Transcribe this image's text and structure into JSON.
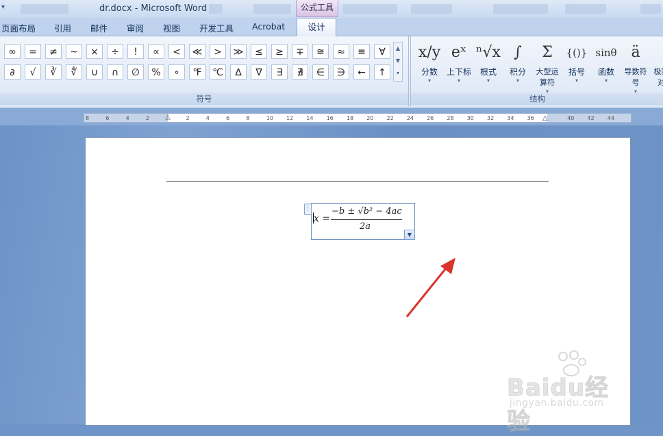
{
  "window": {
    "title": "dr.docx - Microsoft Word",
    "context_tab_group": "公式工具"
  },
  "tabs": [
    {
      "label": "页面布局"
    },
    {
      "label": "引用"
    },
    {
      "label": "邮件"
    },
    {
      "label": "审阅"
    },
    {
      "label": "视图"
    },
    {
      "label": "开发工具"
    },
    {
      "label": "Acrobat"
    },
    {
      "label": "设计",
      "active": true
    }
  ],
  "symbols": {
    "group_label": "符号",
    "row1": [
      "∞",
      "=",
      "≠",
      "~",
      "×",
      "÷",
      "!",
      "∝",
      "<",
      "≪",
      ">",
      "≫",
      "≤",
      "≥",
      "∓",
      "≅",
      "≈",
      "≡",
      "∀"
    ],
    "row2": [
      "∂",
      "√",
      "∛",
      "∜",
      "∪",
      "∩",
      "∅",
      "%",
      "∘",
      "℉",
      "℃",
      "∆",
      "∇",
      "∃",
      "∄",
      "∈",
      "∋",
      "←",
      "↑"
    ]
  },
  "structures": {
    "group_label": "结构",
    "items": [
      {
        "label": "分数",
        "icon": "fraction-icon",
        "glyph": "x/y"
      },
      {
        "label": "上下标",
        "icon": "script-icon",
        "glyph": "eˣ"
      },
      {
        "label": "根式",
        "icon": "radical-icon",
        "glyph": "ⁿ√x"
      },
      {
        "label": "积分",
        "icon": "integral-icon",
        "glyph": "∫"
      },
      {
        "label": "大型运算符",
        "icon": "large-operator-icon",
        "glyph": "Σ"
      },
      {
        "label": "括号",
        "icon": "bracket-icon",
        "glyph": "{()}"
      },
      {
        "label": "函数",
        "icon": "function-icon",
        "glyph": "sinθ"
      },
      {
        "label": "导数符号",
        "icon": "accent-icon",
        "glyph": "ä"
      },
      {
        "label": "极限和对数",
        "icon": "limit-icon",
        "glyph": "l"
      }
    ]
  },
  "ruler": {
    "ticks": [
      "8",
      "6",
      "4",
      "2",
      "",
      "2",
      "4",
      "6",
      "8",
      "10",
      "12",
      "14",
      "16",
      "18",
      "20",
      "22",
      "24",
      "26",
      "28",
      "30",
      "32",
      "34",
      "36",
      "",
      "40",
      "42",
      "44"
    ]
  },
  "equation": {
    "lhs": "x =",
    "numerator": "−b ± √b² − 4ac",
    "denominator": "2a"
  },
  "watermark": {
    "brand": "Baidu经验",
    "url": "jingyan.baidu.com"
  },
  "colors": {
    "accent": "#d8342c",
    "ribbon": "#dbe6f5",
    "workspace": "#6f95c8"
  }
}
